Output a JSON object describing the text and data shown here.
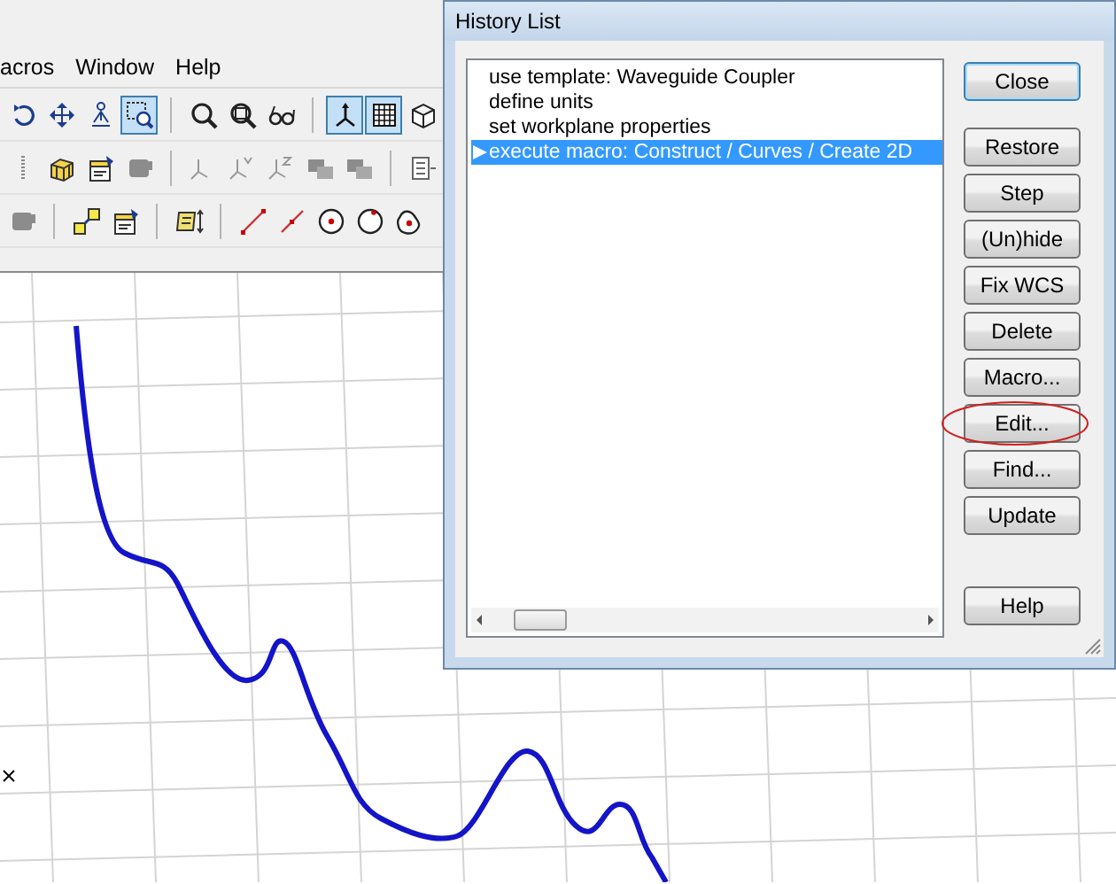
{
  "menu": [
    {
      "label": "acros"
    },
    {
      "label": "Window"
    },
    {
      "label": "Help"
    }
  ],
  "toolbars": [
    [
      {
        "kind": "rotate",
        "pressed": false
      },
      {
        "kind": "pan",
        "pressed": false
      },
      {
        "kind": "walk",
        "pressed": false
      },
      {
        "kind": "zoom-window",
        "pressed": true
      },
      {
        "kind": "separator"
      },
      {
        "kind": "magnifier",
        "pressed": false
      },
      {
        "kind": "zoom-fit",
        "pressed": false
      },
      {
        "kind": "glasses",
        "pressed": false
      },
      {
        "kind": "separator"
      },
      {
        "kind": "axes",
        "pressed": true
      },
      {
        "kind": "grid",
        "pressed": true
      },
      {
        "kind": "cube-view",
        "pressed": false
      }
    ],
    [
      {
        "kind": "grip",
        "pressed": false
      },
      {
        "kind": "cube",
        "pressed": false
      },
      {
        "kind": "properties",
        "pressed": false
      },
      {
        "kind": "shape",
        "pressed": false
      },
      {
        "kind": "separator"
      },
      {
        "kind": "axis-x",
        "pressed": false
      },
      {
        "kind": "axis-y",
        "pressed": false
      },
      {
        "kind": "axis-z",
        "pressed": false
      },
      {
        "kind": "shapes",
        "pressed": false
      },
      {
        "kind": "shapes",
        "pressed": false
      },
      {
        "kind": "separator"
      },
      {
        "kind": "document",
        "pressed": false
      }
    ],
    [
      {
        "kind": "shape",
        "pressed": false
      },
      {
        "kind": "separator"
      },
      {
        "kind": "squares",
        "pressed": false
      },
      {
        "kind": "properties",
        "pressed": false
      },
      {
        "kind": "separator"
      },
      {
        "kind": "scroll",
        "pressed": false
      },
      {
        "kind": "separator"
      },
      {
        "kind": "line",
        "pressed": false
      },
      {
        "kind": "line-short",
        "pressed": false
      },
      {
        "kind": "circle-center",
        "pressed": false
      },
      {
        "kind": "circle-point",
        "pressed": false
      },
      {
        "kind": "blob",
        "pressed": false
      }
    ]
  ],
  "dialog": {
    "title": "History List",
    "items": [
      {
        "label": "use template: Waveguide Coupler",
        "selected": false
      },
      {
        "label": "define units",
        "selected": false
      },
      {
        "label": "set workplane properties",
        "selected": false
      },
      {
        "label": "execute macro: Construct / Curves / Create 2D",
        "selected": true
      }
    ],
    "top_buttons": [
      {
        "label": "Close",
        "default": true,
        "circled": false
      }
    ],
    "middle_buttons": [
      {
        "label": "Restore",
        "default": false,
        "circled": false
      },
      {
        "label": "Step",
        "default": false,
        "circled": false
      },
      {
        "label": "(Un)hide",
        "default": false,
        "circled": false
      },
      {
        "label": "Fix WCS",
        "default": false,
        "circled": false
      },
      {
        "label": "Delete",
        "default": false,
        "circled": false
      },
      {
        "label": "Macro...",
        "default": false,
        "circled": false
      },
      {
        "label": "Edit...",
        "default": false,
        "circled": true
      },
      {
        "label": "Find...",
        "default": false,
        "circled": false
      },
      {
        "label": "Update",
        "default": false,
        "circled": false
      }
    ],
    "bottom_buttons": [
      {
        "label": "Help",
        "default": false,
        "circled": false
      }
    ]
  }
}
